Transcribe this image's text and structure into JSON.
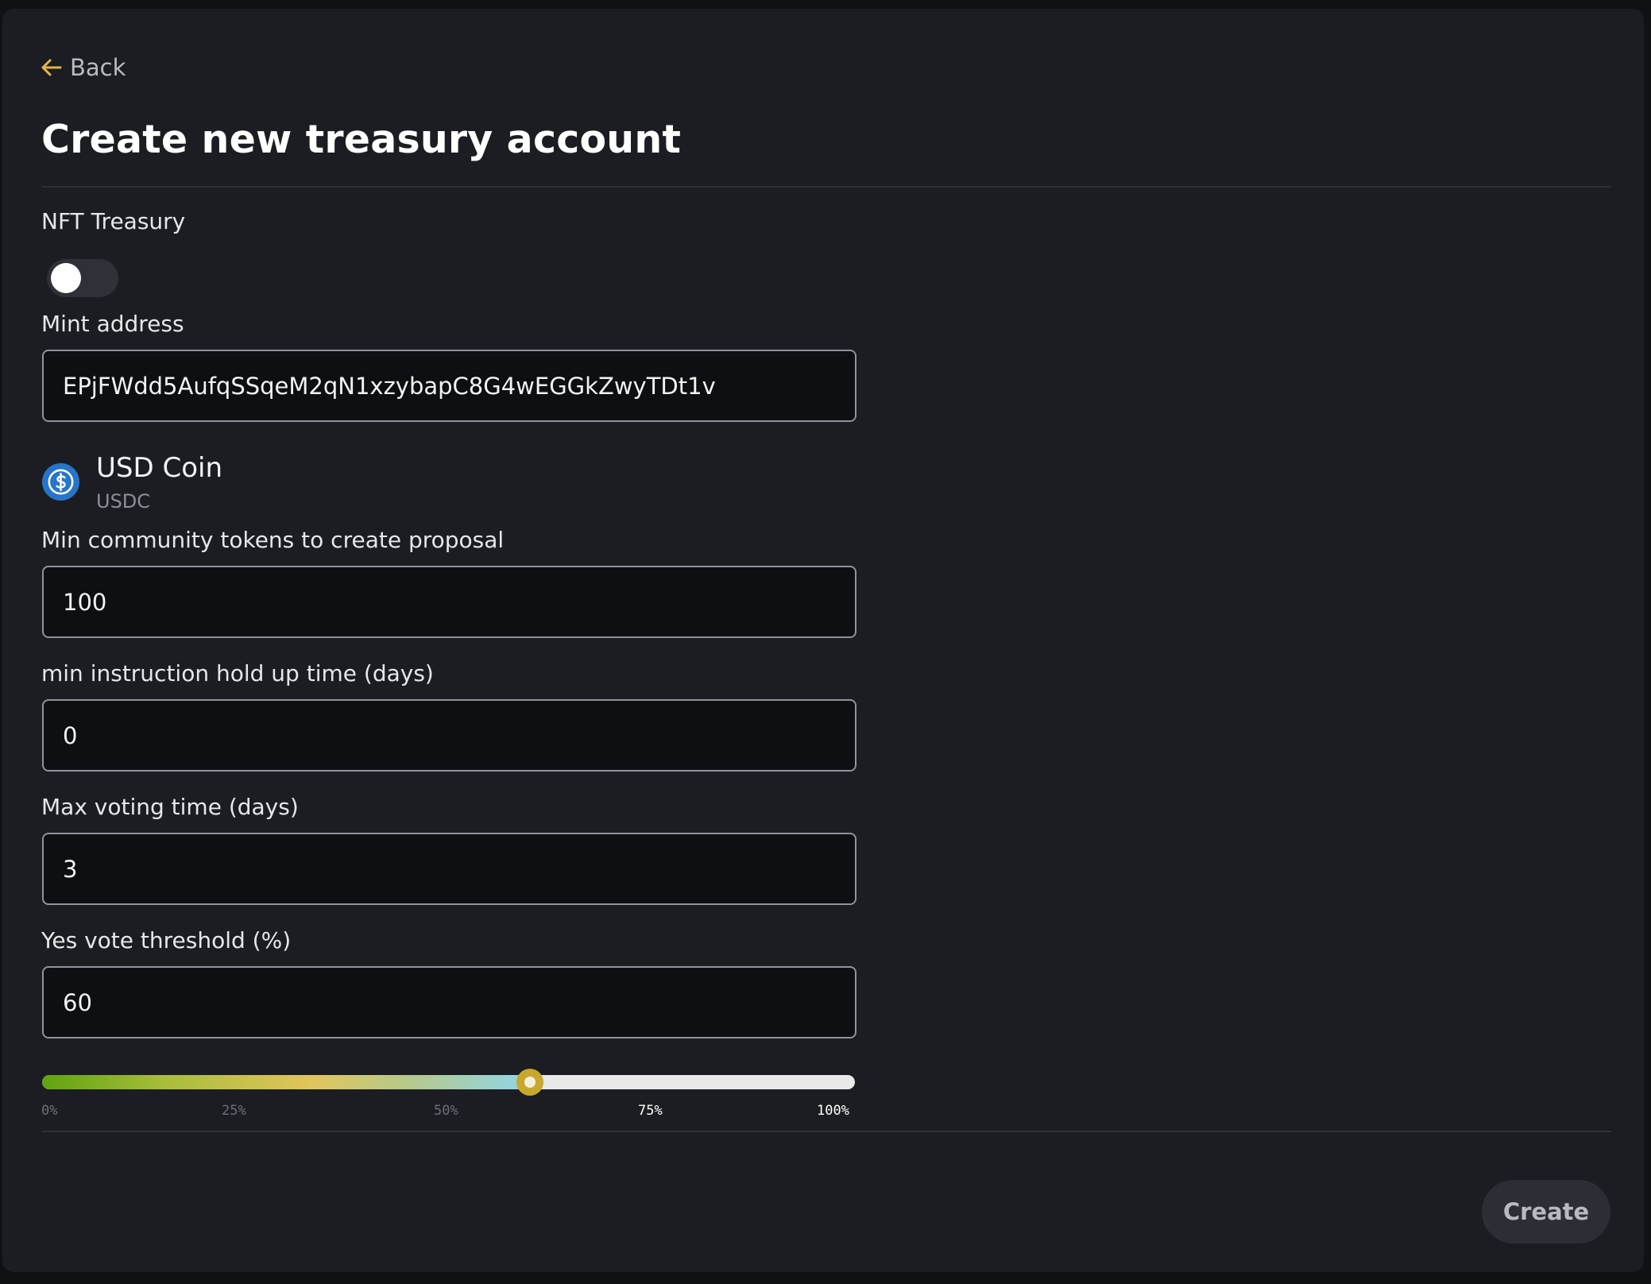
{
  "nav": {
    "back_label": "Back"
  },
  "page": {
    "title": "Create new treasury account"
  },
  "form": {
    "nft_treasury": {
      "label": "NFT Treasury",
      "enabled": false
    },
    "mint_address": {
      "label": "Mint address",
      "value": "EPjFWdd5AufqSSqeM2qN1xzybapC8G4wEGGkZwyTDt1v"
    },
    "token": {
      "name": "USD Coin",
      "symbol": "USDC",
      "icon": "usdc-coin-icon",
      "icon_color": "#2775ca"
    },
    "min_community_tokens": {
      "label": "Min community tokens to create proposal",
      "value": "100"
    },
    "min_hold_up_time": {
      "label": "min instruction hold up time (days)",
      "value": "0"
    },
    "max_voting_time": {
      "label": "Max voting time (days)",
      "value": "3"
    },
    "yes_vote_threshold": {
      "label": "Yes vote threshold (%)",
      "value": "60"
    },
    "threshold_slider": {
      "percent": 60,
      "ticks": [
        "0%",
        "25%",
        "50%",
        "75%",
        "100%"
      ],
      "thumb_color": "#c8a72d"
    }
  },
  "actions": {
    "create_label": "Create"
  },
  "colors": {
    "background": "#1b1d22",
    "accent": "#e2b84a",
    "field_bg": "#0e0f12",
    "field_border": "#8f939c"
  }
}
